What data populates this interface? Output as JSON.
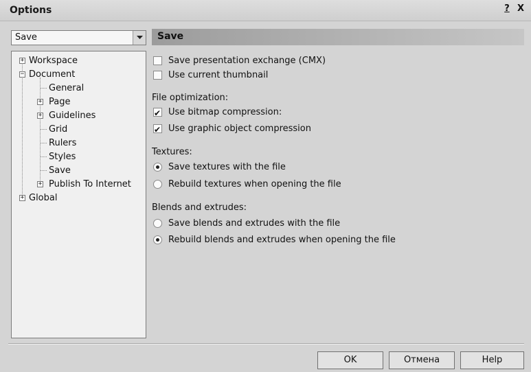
{
  "window": {
    "title": "Options",
    "help_glyph": "?",
    "close_glyph": "X"
  },
  "combo": {
    "value": "Save"
  },
  "tree": [
    {
      "label": "Workspace",
      "expander": "+"
    },
    {
      "label": "Document",
      "expander": "−"
    },
    {
      "label": "General"
    },
    {
      "label": "Page",
      "expander": "+"
    },
    {
      "label": "Guidelines",
      "expander": "+"
    },
    {
      "label": "Grid"
    },
    {
      "label": "Rulers"
    },
    {
      "label": "Styles"
    },
    {
      "label": "Save",
      "selected": true
    },
    {
      "label": "Publish To Internet",
      "expander": "+"
    },
    {
      "label": "Global",
      "expander": "+"
    }
  ],
  "panel": {
    "title": "Save",
    "options": {
      "cmx": {
        "label": "Save presentation exchange (CMX)",
        "checked": false
      },
      "thumbnail": {
        "label": "Use current thumbnail",
        "checked": false
      }
    },
    "file_optimization": {
      "label": "File optimization:",
      "bitmap": {
        "label": "Use bitmap compression:",
        "checked": true
      },
      "graphic": {
        "label": "Use graphic object compression",
        "checked": true
      }
    },
    "textures": {
      "label": "Textures:",
      "save": {
        "label": "Save textures with the file",
        "selected": true
      },
      "rebuild": {
        "label": "Rebuild textures when opening the file",
        "selected": false
      }
    },
    "blends": {
      "label": "Blends and extrudes:",
      "save": {
        "label": "Save blends and extrudes with the file",
        "selected": false
      },
      "rebuild": {
        "label": "Rebuild blends and extrudes when opening the file",
        "selected": true
      }
    }
  },
  "buttons": {
    "ok": "OK",
    "cancel": "Отмена",
    "help": "Help"
  }
}
